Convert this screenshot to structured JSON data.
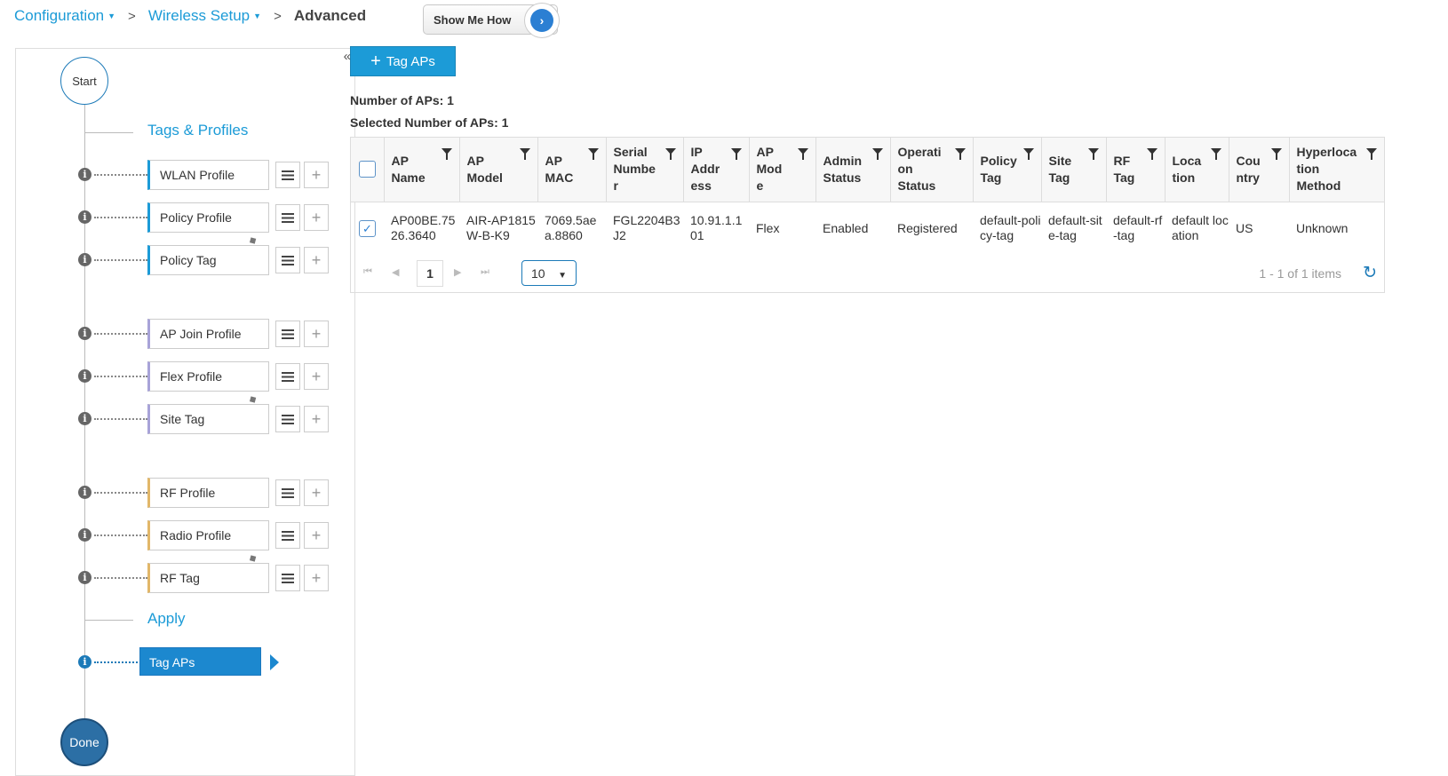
{
  "breadcrumb": {
    "items": [
      {
        "label": "Configuration"
      },
      {
        "label": "Wireless Setup"
      }
    ],
    "current": "Advanced"
  },
  "show_me_how": {
    "label": "Show Me How",
    "icon": "chevron-right-icon"
  },
  "wizard": {
    "start_label": "Start",
    "done_label": "Done",
    "sections": {
      "tags_profiles": "Tags & Profiles",
      "apply": "Apply"
    },
    "steps": [
      {
        "label": "WLAN Profile",
        "group": "policy",
        "color": "#1c9bd7"
      },
      {
        "label": "Policy Profile",
        "group": "policy",
        "color": "#1c9bd7"
      },
      {
        "label": "Policy Tag",
        "group": "policy",
        "color": "#1c9bd7"
      },
      {
        "label": "AP Join Profile",
        "group": "site",
        "color": "#a8a3d8"
      },
      {
        "label": "Flex Profile",
        "group": "site",
        "color": "#a8a3d8"
      },
      {
        "label": "Site Tag",
        "group": "site",
        "color": "#a8a3d8"
      },
      {
        "label": "RF Profile",
        "group": "rf",
        "color": "#e2b769"
      },
      {
        "label": "Radio Profile",
        "group": "rf",
        "color": "#e2b769"
      },
      {
        "label": "RF Tag",
        "group": "rf",
        "color": "#e2b769"
      }
    ],
    "active_step": "Tag APs"
  },
  "toolbar": {
    "tag_aps_label": "Tag APs"
  },
  "counts": {
    "number_of_aps": "Number of APs: 1",
    "selected_number_of_aps": "Selected Number of APs: 1"
  },
  "table": {
    "columns": [
      "AP Name",
      "AP Model",
      "AP MAC",
      "Serial Number",
      "IP Address",
      "AP Mode",
      "Admin Status",
      "Operation Status",
      "Policy Tag",
      "Site Tag",
      "RF Tag",
      "Location",
      "Country",
      "Hyperlocation Method"
    ],
    "column_lines": [
      "AP\nName",
      "AP\nModel",
      "AP\nMAC",
      "Serial\nNumbe\nr",
      "IP\nAddr\ness",
      "AP\nMod\ne",
      "Admin\nStatus",
      "Operati\non\nStatus",
      "Policy\nTag",
      "Site\nTag",
      "RF\nTag",
      "Loca\ntion",
      "Cou\nntry",
      "Hyperloca\ntion\nMethod"
    ],
    "rows": [
      {
        "selected": true,
        "cells": [
          "AP00BE.7526.3640",
          "AIR-AP1815W-B-K9",
          "7069.5aea.8860",
          "FGL2204B3J2",
          "10.91.1.101",
          "Flex",
          "Enabled",
          "Registered",
          "default-policy-tag",
          "default-site-tag",
          "default-rf-tag",
          "default location",
          "US",
          "Unknown"
        ]
      }
    ]
  },
  "pager": {
    "current_page": "1",
    "page_size": "10",
    "info": "1 - 1 of 1 items"
  }
}
